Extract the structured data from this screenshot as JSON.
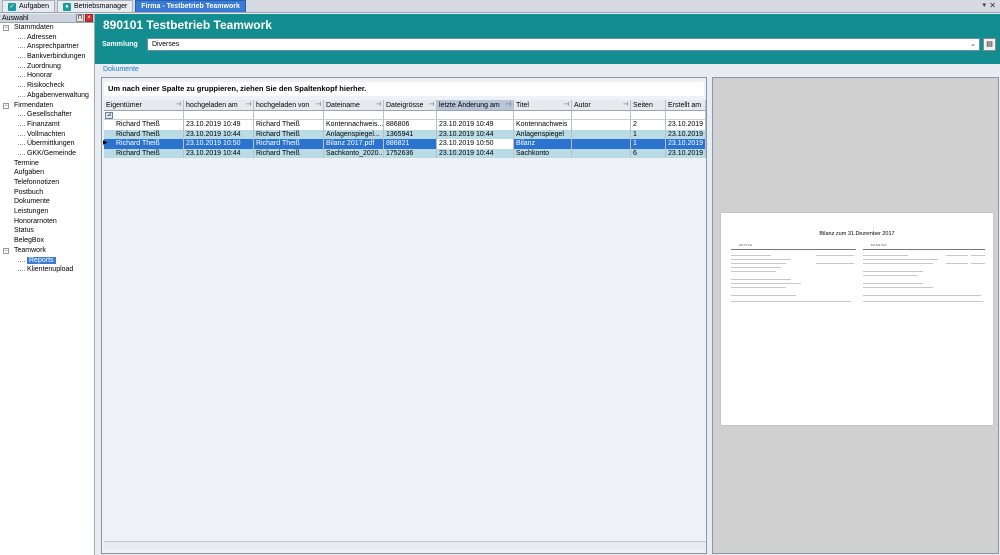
{
  "tabs": [
    {
      "label": "Aufgaben",
      "active": false
    },
    {
      "label": "Betriebsmanager",
      "active": false
    },
    {
      "label": "Firma - Testbetrieb Teamwork",
      "active": true
    }
  ],
  "sidebar": {
    "title": "Auswahl",
    "items": [
      {
        "label": "Stammdaten",
        "level": 1,
        "expander": "-"
      },
      {
        "label": "Adressen",
        "level": 2
      },
      {
        "label": "Ansprechpartner",
        "level": 2
      },
      {
        "label": "Bankverbindungen",
        "level": 2
      },
      {
        "label": "Zuordnung",
        "level": 2
      },
      {
        "label": "Honorar",
        "level": 2
      },
      {
        "label": "Risikocheck",
        "level": 2
      },
      {
        "label": "Abgabenverwaltung",
        "level": 2
      },
      {
        "label": "Firmendaten",
        "level": 1,
        "expander": "-"
      },
      {
        "label": "Gesellschafter",
        "level": 2
      },
      {
        "label": "Finanzamt",
        "level": 2
      },
      {
        "label": "Vollmachten",
        "level": 2
      },
      {
        "label": "Übermittlungen",
        "level": 2
      },
      {
        "label": "GKK/Gemeinde",
        "level": 2
      },
      {
        "label": "Termine",
        "level": 1
      },
      {
        "label": "Aufgaben",
        "level": 1
      },
      {
        "label": "Telefonnotizen",
        "level": 1
      },
      {
        "label": "Postbuch",
        "level": 1
      },
      {
        "label": "Dokumente",
        "level": 1
      },
      {
        "label": "Leistungen",
        "level": 1
      },
      {
        "label": "Honorarnoten",
        "level": 1
      },
      {
        "label": "Status",
        "level": 1
      },
      {
        "label": "BelegBox",
        "level": 1
      },
      {
        "label": "Teamwork",
        "level": 1,
        "expander": "-"
      },
      {
        "label": "Reports",
        "level": 2,
        "selected": true
      },
      {
        "label": "Klientenupload",
        "level": 2
      }
    ]
  },
  "header": {
    "title": "890101 Testbetrieb Teamwork",
    "sammlung_label": "Sammlung",
    "sammlung_value": "Diverses"
  },
  "documents_link": "Dokumente",
  "grid": {
    "group_hint": "Um nach einer Spalte zu gruppieren, ziehen Sie den Spaltenkopf hierher.",
    "columns": [
      "Eigentümer",
      "hochgeladen am",
      "hochgeladen von",
      "Dateiname",
      "Dateigrösse",
      "letzte Änderung am",
      "Titel",
      "Autor",
      "Seiten",
      "Erstellt am"
    ],
    "rows": [
      [
        "Richard Theiß",
        "23.10.2019 10:49",
        "Richard Theiß",
        "Kontennachweis...",
        "886806",
        "23.10.2019 10:49",
        "Kontennachweis",
        "",
        "2",
        "23.10.2019"
      ],
      [
        "Richard Theiß",
        "23.10.2019 10:44",
        "Richard Theiß",
        "Anlagenspiegel...",
        "1365941",
        "23.10.2019 10:44",
        "Anlagenspiegel",
        "",
        "1",
        "23.10.2019"
      ],
      [
        "Richard Theiß",
        "23.10.2019 10:50",
        "Richard Theiß",
        "Bilanz 2017.pdf",
        "886821",
        "23.10.2019 10:50",
        "Bilanz",
        "",
        "1",
        "23.10.2019"
      ],
      [
        "Richard Theiß",
        "23.10.2019 10:44",
        "Richard Theiß",
        "Sachkonto_2020...",
        "1752636",
        "23.10.2019 10:44",
        "Sachkonto",
        "",
        "6",
        "23.10.2019"
      ]
    ],
    "selected_row": 2
  },
  "preview": {
    "page_title": "Bilanz zum 31.Dezember 2017",
    "left_heading": "AKTIVA",
    "right_heading": "PASSIVA"
  },
  "colors": {
    "teal": "#138d8f",
    "accent": "#3a7bd5",
    "row_alt": "#b8dbe6"
  }
}
